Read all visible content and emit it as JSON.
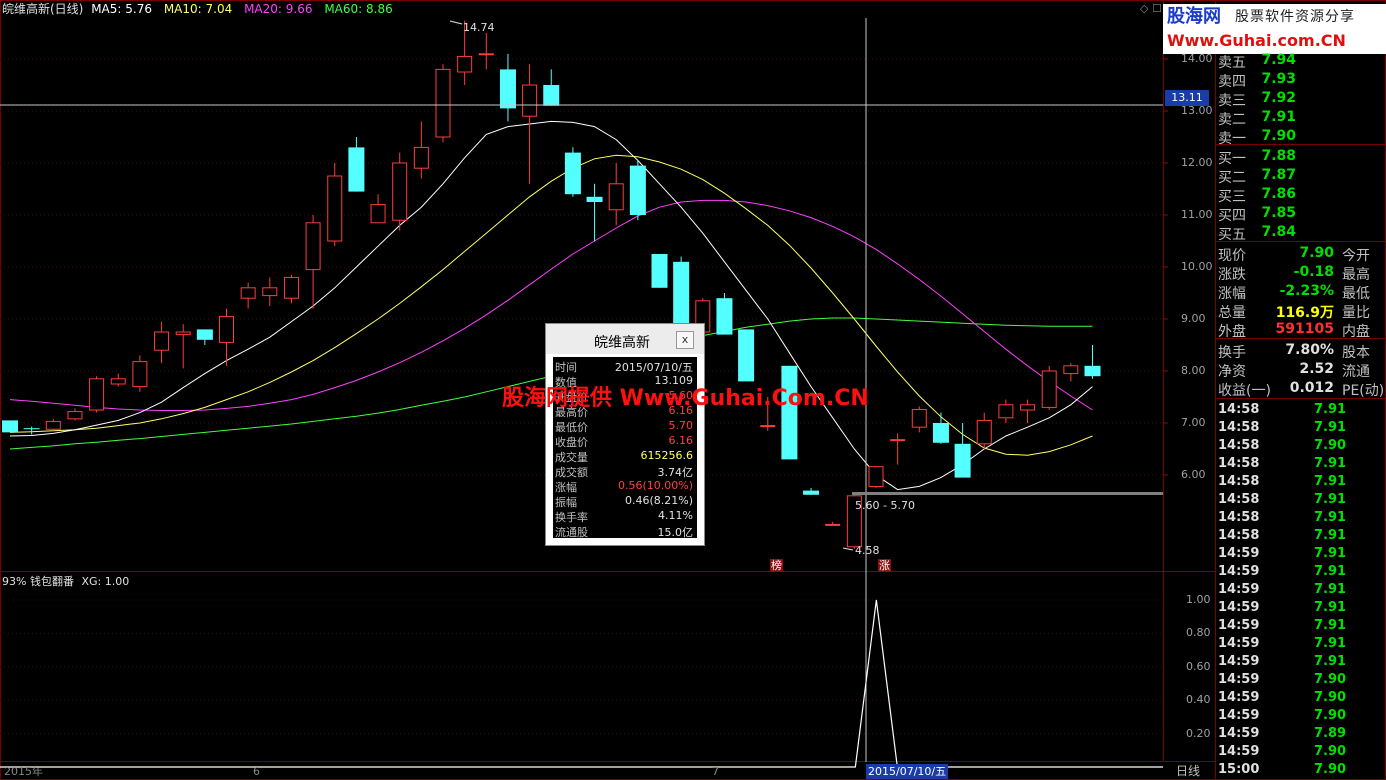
{
  "header": {
    "stock_title": "皖维高新(日线)",
    "ma5": "MA5: 5.76",
    "ma10": "MA10: 7.04",
    "ma20": "MA20: 9.66",
    "ma60": "MA60: 8.86",
    "colors": {
      "ma5": "#ffffff",
      "ma10": "#ffff66",
      "ma20": "#ff40ff",
      "ma60": "#40ff40"
    }
  },
  "logo": {
    "brand": "股海网",
    "slogan": "股票软件资源分享",
    "url": "Www.Guhai.com.CN"
  },
  "price_axis": [
    "14.00",
    "13.00",
    "12.00",
    "11.00",
    "10.00",
    "9.00",
    "8.00",
    "7.00",
    "6.00"
  ],
  "crosshair_price": "13.11",
  "annotations": {
    "high": "14.74",
    "low": "4.58",
    "range": "5.60 - 5.70",
    "badge1": "榜",
    "badge2": "涨"
  },
  "indicator": {
    "title": "93% 钱包翻番",
    "xg": "XG: 1.00",
    "axis": [
      "1.00",
      "0.80",
      "0.60",
      "0.40",
      "0.20"
    ]
  },
  "date_axis": {
    "labels": [
      "2015年",
      "6",
      "7"
    ],
    "cursor_date": "2015/07/10/五",
    "period": "日线"
  },
  "chart_data": {
    "type": "candlestick",
    "ylim": [
      4.2,
      14.9
    ],
    "candles": [
      [
        7.05,
        7.0,
        6.82,
        6.82
      ],
      [
        6.9,
        6.93,
        6.78,
        6.88
      ],
      [
        6.88,
        7.08,
        6.85,
        7.03
      ],
      [
        7.08,
        7.28,
        7.05,
        7.22
      ],
      [
        7.25,
        7.9,
        7.2,
        7.85
      ],
      [
        7.75,
        7.95,
        7.7,
        7.85
      ],
      [
        7.7,
        8.3,
        7.6,
        8.18
      ],
      [
        8.4,
        8.95,
        8.15,
        8.75
      ],
      [
        8.7,
        8.9,
        8.05,
        8.75
      ],
      [
        8.8,
        8.8,
        8.5,
        8.6
      ],
      [
        8.55,
        9.2,
        8.1,
        9.05
      ],
      [
        9.4,
        9.7,
        9.2,
        9.6
      ],
      [
        9.45,
        9.8,
        9.25,
        9.6
      ],
      [
        9.4,
        9.85,
        9.3,
        9.8
      ],
      [
        9.95,
        11.0,
        9.2,
        10.85
      ],
      [
        10.5,
        12.0,
        10.4,
        11.75
      ],
      [
        12.3,
        12.5,
        11.45,
        11.45
      ],
      [
        10.85,
        11.4,
        10.9,
        11.2
      ],
      [
        10.9,
        12.2,
        10.7,
        12.0
      ],
      [
        11.9,
        12.8,
        11.7,
        12.3
      ],
      [
        12.5,
        13.9,
        12.4,
        13.8
      ],
      [
        13.75,
        14.74,
        13.5,
        14.05
      ],
      [
        14.1,
        14.5,
        13.8,
        14.1
      ],
      [
        13.8,
        14.1,
        12.8,
        13.05
      ],
      [
        12.9,
        13.9,
        11.6,
        13.5
      ],
      [
        13.5,
        13.8,
        13.1,
        13.1
      ],
      [
        12.2,
        12.3,
        11.35,
        11.4
      ],
      [
        11.35,
        11.6,
        10.5,
        11.25
      ],
      [
        11.1,
        12.0,
        10.8,
        11.6
      ],
      [
        11.95,
        12.05,
        10.9,
        11.0
      ],
      [
        10.25,
        10.25,
        9.6,
        9.6
      ],
      [
        10.1,
        10.2,
        8.7,
        8.75
      ],
      [
        8.75,
        9.4,
        8.15,
        9.35
      ],
      [
        9.4,
        9.5,
        8.7,
        8.7
      ],
      [
        8.8,
        8.8,
        7.8,
        7.8
      ],
      [
        6.95,
        7.5,
        6.85,
        6.95
      ],
      [
        8.1,
        8.1,
        6.3,
        6.3
      ],
      [
        5.7,
        5.75,
        5.62,
        5.62
      ],
      [
        5.05,
        5.1,
        5.05,
        5.05
      ],
      [
        4.62,
        5.65,
        4.58,
        5.6
      ],
      [
        5.78,
        6.16,
        5.75,
        6.16
      ],
      [
        6.68,
        6.8,
        6.2,
        6.68
      ],
      [
        6.92,
        7.32,
        6.82,
        7.26
      ],
      [
        7.0,
        7.2,
        6.6,
        6.62
      ],
      [
        6.6,
        7.0,
        5.95,
        5.95
      ],
      [
        6.6,
        7.2,
        6.5,
        7.05
      ],
      [
        7.1,
        7.45,
        7.0,
        7.35
      ],
      [
        7.25,
        7.45,
        7.0,
        7.35
      ],
      [
        7.3,
        8.1,
        7.25,
        8.0
      ],
      [
        7.95,
        8.15,
        7.8,
        8.1
      ],
      [
        8.1,
        8.5,
        7.85,
        7.9
      ]
    ],
    "ma5": [
      6.75,
      6.76,
      6.8,
      6.87,
      6.96,
      7.05,
      7.2,
      7.4,
      7.68,
      7.95,
      8.2,
      8.42,
      8.65,
      8.95,
      9.25,
      9.6,
      10.0,
      10.4,
      10.8,
      11.15,
      11.6,
      12.1,
      12.55,
      12.7,
      12.75,
      12.8,
      12.78,
      12.7,
      12.45,
      12.05,
      11.6,
      11.15,
      10.65,
      10.1,
      9.55,
      9.0,
      8.35,
      7.7,
      7.1,
      6.5,
      6.0,
      5.72,
      5.78,
      5.95,
      6.2,
      6.5,
      6.75,
      6.92,
      7.1,
      7.35,
      7.7
    ],
    "ma10": [
      6.82,
      6.83,
      6.85,
      6.87,
      6.9,
      6.95,
      7.0,
      7.08,
      7.18,
      7.3,
      7.45,
      7.6,
      7.78,
      7.98,
      8.2,
      8.45,
      8.72,
      9.0,
      9.3,
      9.62,
      9.95,
      10.3,
      10.65,
      11.0,
      11.35,
      11.65,
      11.9,
      12.08,
      12.15,
      12.12,
      12.02,
      11.88,
      11.68,
      11.42,
      11.12,
      10.8,
      10.42,
      9.98,
      9.5,
      9.0,
      8.48,
      7.98,
      7.52,
      7.12,
      6.78,
      6.52,
      6.4,
      6.38,
      6.45,
      6.58,
      6.75
    ],
    "ma20": [
      7.45,
      7.42,
      7.38,
      7.34,
      7.3,
      7.27,
      7.25,
      7.24,
      7.24,
      7.25,
      7.28,
      7.32,
      7.38,
      7.45,
      7.55,
      7.68,
      7.82,
      7.98,
      8.16,
      8.36,
      8.58,
      8.82,
      9.08,
      9.36,
      9.66,
      9.96,
      10.25,
      10.5,
      10.75,
      10.98,
      11.15,
      11.25,
      11.28,
      11.28,
      11.25,
      11.18,
      11.08,
      10.95,
      10.78,
      10.58,
      10.34,
      10.06,
      9.76,
      9.44,
      9.1,
      8.76,
      8.42,
      8.1,
      7.8,
      7.52,
      7.25
    ],
    "ma60": [
      6.5,
      6.53,
      6.56,
      6.6,
      6.63,
      6.67,
      6.7,
      6.74,
      6.78,
      6.82,
      6.86,
      6.9,
      6.94,
      6.98,
      7.03,
      7.08,
      7.13,
      7.19,
      7.26,
      7.34,
      7.42,
      7.5,
      7.6,
      7.7,
      7.8,
      7.9,
      8.02,
      8.14,
      8.26,
      8.38,
      8.48,
      8.58,
      8.68,
      8.76,
      8.84,
      8.9,
      8.96,
      9.0,
      9.02,
      9.02,
      9.0,
      8.98,
      8.96,
      8.94,
      8.92,
      8.9,
      8.88,
      8.87,
      8.86,
      8.86,
      8.86
    ],
    "signal": {
      "x_index": 39,
      "value": 1.0
    }
  },
  "order_book": {
    "asks": [
      {
        "label": "卖五",
        "price": "7.94"
      },
      {
        "label": "卖四",
        "price": "7.93"
      },
      {
        "label": "卖三",
        "price": "7.92"
      },
      {
        "label": "卖二",
        "price": "7.91"
      },
      {
        "label": "卖一",
        "price": "7.90"
      }
    ],
    "bids": [
      {
        "label": "买一",
        "price": "7.88"
      },
      {
        "label": "买二",
        "price": "7.87"
      },
      {
        "label": "买三",
        "price": "7.86"
      },
      {
        "label": "买四",
        "price": "7.85"
      },
      {
        "label": "买五",
        "price": "7.84"
      }
    ]
  },
  "quote": [
    {
      "label": "现价",
      "value": "7.90",
      "value_color": "#00e000",
      "label2": "今开"
    },
    {
      "label": "涨跌",
      "value": "-0.18",
      "value_color": "#00e000",
      "label2": "最高"
    },
    {
      "label": "涨幅",
      "value": "-2.23%",
      "value_color": "#00e000",
      "label2": "最低"
    },
    {
      "label": "总量",
      "value": "116.9万",
      "value_color": "#ffff00",
      "label2": "量比"
    },
    {
      "label": "外盘",
      "value": "591105",
      "value_color": "#ff3030",
      "label2": "内盘"
    },
    {
      "label": "换手",
      "value": "7.80%",
      "value_color": "#e0e0e0",
      "label2": "股本"
    },
    {
      "label": "净资",
      "value": "2.52",
      "value_color": "#e0e0e0",
      "label2": "流通"
    },
    {
      "label": "收益(一)",
      "value": "0.012",
      "value_color": "#e0e0e0",
      "label2": "PE(动)"
    }
  ],
  "ticks": [
    {
      "time": "14:58",
      "price": "7.91"
    },
    {
      "time": "14:58",
      "price": "7.91"
    },
    {
      "time": "14:58",
      "price": "7.90"
    },
    {
      "time": "14:58",
      "price": "7.91"
    },
    {
      "time": "14:58",
      "price": "7.91"
    },
    {
      "time": "14:58",
      "price": "7.91"
    },
    {
      "time": "14:58",
      "price": "7.91"
    },
    {
      "time": "14:58",
      "price": "7.91"
    },
    {
      "time": "14:59",
      "price": "7.91"
    },
    {
      "time": "14:59",
      "price": "7.91"
    },
    {
      "time": "14:59",
      "price": "7.91"
    },
    {
      "time": "14:59",
      "price": "7.91"
    },
    {
      "time": "14:59",
      "price": "7.91"
    },
    {
      "time": "14:59",
      "price": "7.91"
    },
    {
      "time": "14:59",
      "price": "7.91"
    },
    {
      "time": "14:59",
      "price": "7.90"
    },
    {
      "time": "14:59",
      "price": "7.90"
    },
    {
      "time": "14:59",
      "price": "7.90"
    },
    {
      "time": "14:59",
      "price": "7.89"
    },
    {
      "time": "14:59",
      "price": "7.90"
    },
    {
      "time": "15:00",
      "price": "7.90"
    }
  ],
  "popup": {
    "title": "皖维高新",
    "close": "x",
    "rows": [
      {
        "label": "时间",
        "value": "2015/07/10/五",
        "color": "#e0e0e0"
      },
      {
        "label": "数值",
        "value": "13.109",
        "color": "#e0e0e0"
      },
      {
        "label": "开盘价",
        "value": "5.60",
        "color": "#ff4040"
      },
      {
        "label": "最高价",
        "value": "6.16",
        "color": "#ff4040"
      },
      {
        "label": "最低价",
        "value": "5.70",
        "color": "#ff4040"
      },
      {
        "label": "收盘价",
        "value": "6.16",
        "color": "#ff4040"
      },
      {
        "label": "成交量",
        "value": "615256.6",
        "color": "#ffff66"
      },
      {
        "label": "成交额",
        "value": "3.74亿",
        "color": "#e0e0e0"
      },
      {
        "label": "涨幅",
        "value": "0.56(10.00%)",
        "color": "#ff4040"
      },
      {
        "label": "振幅",
        "value": "0.46(8.21%)",
        "color": "#e0e0e0"
      },
      {
        "label": "换手率",
        "value": "4.11%",
        "color": "#e0e0e0"
      },
      {
        "label": "流通股",
        "value": "15.0亿",
        "color": "#e0e0e0"
      }
    ]
  },
  "watermark": "股海网提供 Www.Guhai.Com.CN"
}
